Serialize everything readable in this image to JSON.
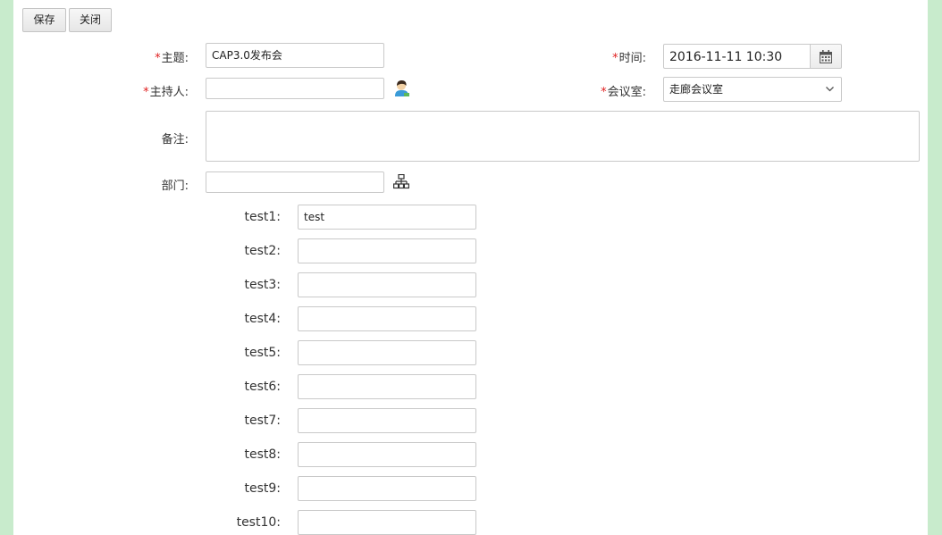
{
  "toolbar": {
    "save_label": "保存",
    "close_label": "关闭"
  },
  "form": {
    "required_mark": "*",
    "subject": {
      "label": "主题:",
      "value": "CAP3.0发布会"
    },
    "time": {
      "label": "时间:",
      "value": "2016-11-11 10:30"
    },
    "host": {
      "label": "主持人:",
      "value": ""
    },
    "room": {
      "label": "会议室:",
      "value": "走廊会议室"
    },
    "remark": {
      "label": "备注:",
      "value": ""
    },
    "department": {
      "label": "部门:",
      "value": ""
    }
  },
  "tests": [
    {
      "label": "test1:",
      "value": "test"
    },
    {
      "label": "test2:",
      "value": ""
    },
    {
      "label": "test3:",
      "value": ""
    },
    {
      "label": "test4:",
      "value": ""
    },
    {
      "label": "test5:",
      "value": ""
    },
    {
      "label": "test6:",
      "value": ""
    },
    {
      "label": "test7:",
      "value": ""
    },
    {
      "label": "test8:",
      "value": ""
    },
    {
      "label": "test9:",
      "value": ""
    },
    {
      "label": "test10:",
      "value": ""
    }
  ],
  "icons": {
    "host_picker": "person-select-icon",
    "department_picker": "org-tree-icon",
    "time_picker": "calendar-icon",
    "room_dropdown": "chevron-down-icon"
  }
}
